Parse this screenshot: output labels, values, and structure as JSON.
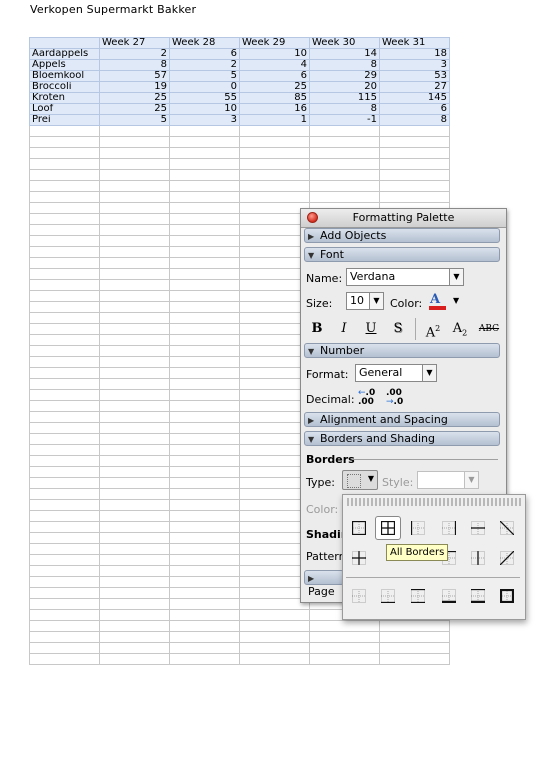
{
  "document": {
    "title": "Verkopen Supermarkt Bakker"
  },
  "sheet": {
    "headers": [
      "",
      "Week 27",
      "Week 28",
      "Week 29",
      "Week 30",
      "Week 31"
    ],
    "rows": [
      {
        "label": "Aardappels",
        "values": [
          "2",
          "6",
          "10",
          "14",
          "18"
        ]
      },
      {
        "label": "Appels",
        "values": [
          "8",
          "2",
          "4",
          "8",
          "3"
        ]
      },
      {
        "label": "Bloemkool",
        "values": [
          "57",
          "5",
          "6",
          "29",
          "53"
        ]
      },
      {
        "label": "Broccoli",
        "values": [
          "19",
          "0",
          "25",
          "20",
          "27"
        ]
      },
      {
        "label": "Kroten",
        "values": [
          "25",
          "55",
          "85",
          "115",
          "145"
        ]
      },
      {
        "label": "Loof",
        "values": [
          "25",
          "10",
          "16",
          "8",
          "6"
        ]
      },
      {
        "label": "Prei",
        "values": [
          "5",
          "3",
          "1",
          "-1",
          "8"
        ]
      }
    ]
  },
  "palette": {
    "title": "Formatting Palette",
    "sections": {
      "add_objects": "Add Objects",
      "font": "Font",
      "number": "Number",
      "alignment": "Alignment and Spacing",
      "borders_shading": "Borders and Shading"
    },
    "font": {
      "name_label": "Name:",
      "name_value": "Verdana",
      "size_label": "Size:",
      "size_value": "10",
      "color_label": "Color:",
      "bold": "B",
      "italic": "I",
      "underline": "U",
      "shadow": "S",
      "superscript": "A",
      "superscript_mark": "2",
      "subscript": "A",
      "subscript_mark": "2",
      "strikethrough": "ABC"
    },
    "number": {
      "format_label": "Format:",
      "format_value": "General",
      "decimal_label": "Decimal:"
    },
    "borders": {
      "heading": "Borders",
      "type_label": "Type:",
      "style_label": "Style:",
      "color_label": "Color:",
      "shading_heading": "Shadin",
      "pattern_label": "Pattern",
      "page_label": "Page"
    },
    "colors": {
      "font_color": "#d81e1e",
      "section_bg": "#c3cedd"
    }
  },
  "borders_popup": {
    "tooltip": "All Borders",
    "selected": "all-borders"
  }
}
